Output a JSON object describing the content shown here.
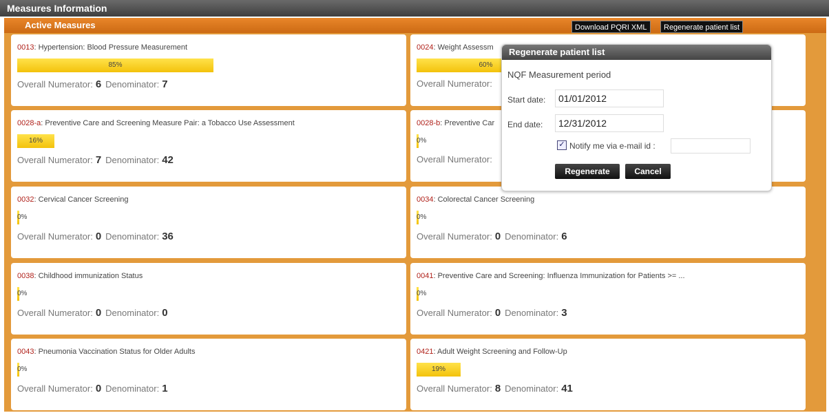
{
  "window": {
    "title": "Measures Information"
  },
  "panel": {
    "title": "Active Measures",
    "download_label": "Download PQRI XML",
    "regenerate_label": "Regenerate patient list"
  },
  "labels": {
    "numerator": "Overall Numerator:",
    "denominator": "Denominator:"
  },
  "measures": [
    {
      "code": "0013",
      "name": ": Hypertension: Blood Pressure Measurement",
      "percent_label": "85%",
      "percent": 85,
      "numerator": "6",
      "denominator": "7"
    },
    {
      "code": "0024",
      "name": ": Weight Assessm",
      "percent_label": "60%",
      "percent": 60,
      "numerator": "",
      "denominator": ""
    },
    {
      "code": "0028-a",
      "name": ": Preventive Care and Screening Measure Pair: a Tobacco Use Assessment",
      "percent_label": "16%",
      "percent": 16,
      "numerator": "7",
      "denominator": "42"
    },
    {
      "code": "0028-b",
      "name": ": Preventive Car",
      "percent_label": "0%",
      "percent": 0,
      "numerator": "",
      "denominator": ""
    },
    {
      "code": "0032",
      "name": ": Cervical Cancer Screening",
      "percent_label": "0%",
      "percent": 0,
      "numerator": "0",
      "denominator": "36"
    },
    {
      "code": "0034",
      "name": ": Colorectal Cancer Screening",
      "percent_label": "0%",
      "percent": 0,
      "numerator": "0",
      "denominator": "6"
    },
    {
      "code": "0038",
      "name": ": Childhood immunization Status",
      "percent_label": "0%",
      "percent": 0,
      "numerator": "0",
      "denominator": "0"
    },
    {
      "code": "0041",
      "name": ": Preventive Care and Screening: Influenza Immunization for Patients >= ...",
      "percent_label": "0%",
      "percent": 0,
      "numerator": "0",
      "denominator": "3"
    },
    {
      "code": "0043",
      "name": ": Pneumonia Vaccination Status for Older Adults",
      "percent_label": "0%",
      "percent": 0,
      "numerator": "0",
      "denominator": "1"
    },
    {
      "code": "0421",
      "name": ": Adult Weight Screening and Follow-Up",
      "percent_label": "19%",
      "percent": 19,
      "numerator": "8",
      "denominator": "41"
    }
  ],
  "dialog": {
    "title": "Regenerate patient list",
    "period_label": "NQF Measurement period",
    "start_label": "Start date:",
    "start_value": "01/01/2012",
    "end_label": "End date:",
    "end_value": "12/31/2012",
    "notify_label": "Notify me via e-mail id :",
    "notify_checked": true,
    "email_value": "",
    "regenerate_button": "Regenerate",
    "cancel_button": "Cancel"
  },
  "colors": {
    "accent": "#e39a3b",
    "bar": "#f3c20c",
    "code": "#b0211a"
  }
}
